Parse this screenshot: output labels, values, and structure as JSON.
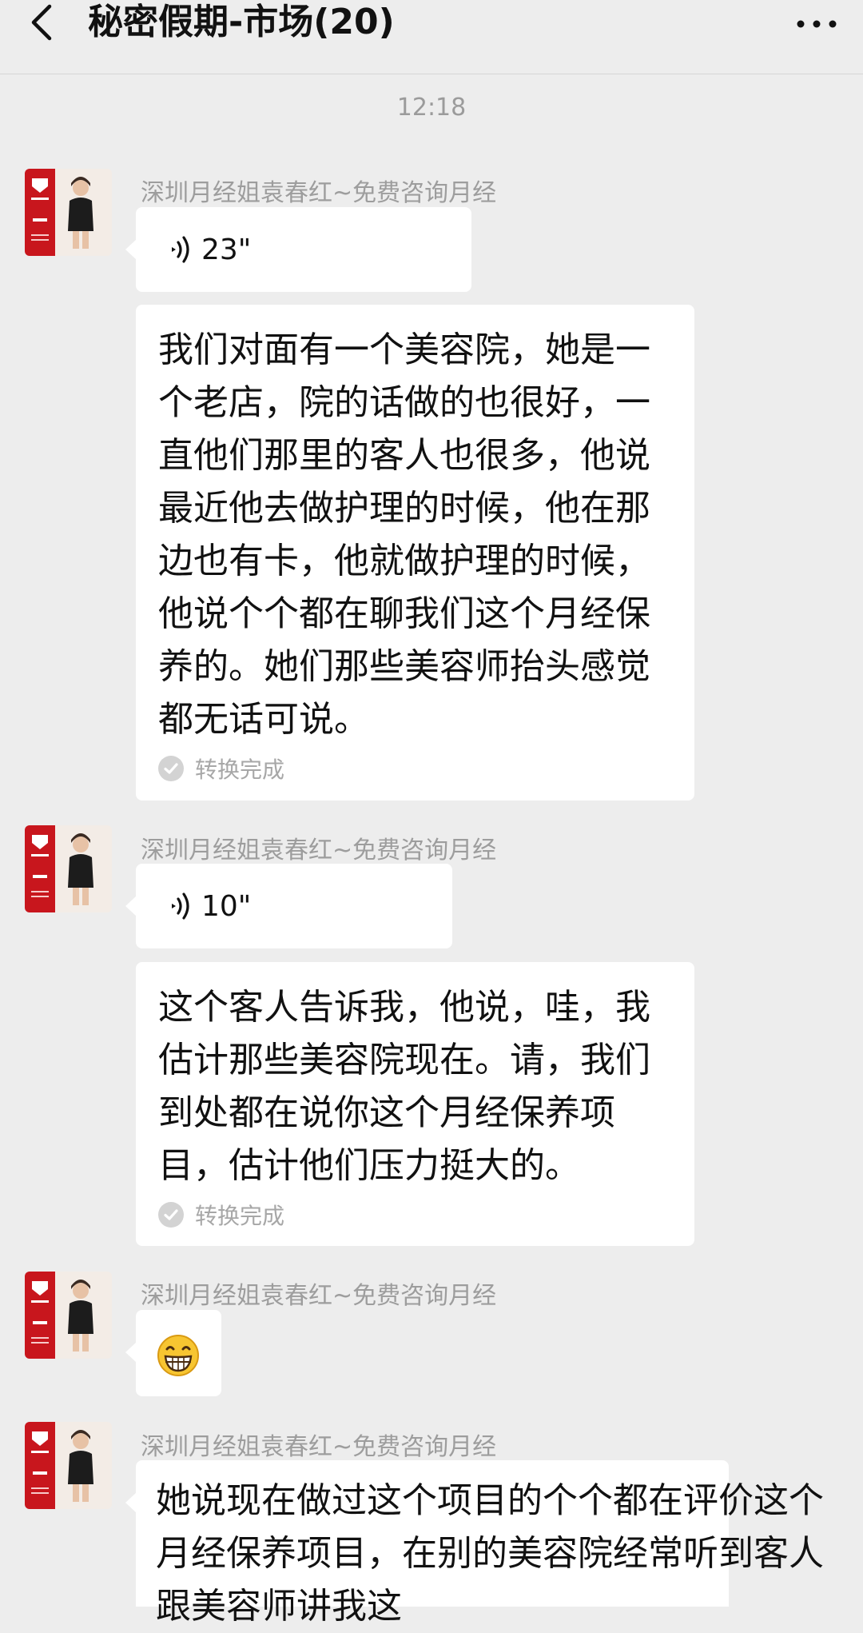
{
  "header": {
    "title": "秘密假期-市场(20)",
    "back_icon": "chevron-left-icon",
    "more_icon": "more-dots-icon"
  },
  "timestamp": "12:18",
  "avatar": {
    "accent": "#c8161d",
    "badge_text": "袁春红"
  },
  "messages": [
    {
      "sender": "深圳月经姐袁春红~免费咨询月经",
      "voice_duration": "23\"",
      "transcript": "我们对面有一个美容院，她是一个老店，院的话做的也很好，一直他们那里的客人也很多，他说最近他去做护理的时候，他在那边也有卡，他就做护理的时候，他说个个都在聊我们这个月经保养的。她们那些美容师抬头感觉都无话可说。",
      "transcript_status": "转换完成"
    },
    {
      "sender": "深圳月经姐袁春红~免费咨询月经",
      "voice_duration": "10\"",
      "transcript": "这个客人告诉我，他说，哇，我估计那些美容院现在。请，我们到处都在说你这个月经保养项目，估计他们压力挺大的。",
      "transcript_status": "转换完成"
    },
    {
      "sender": "深圳月经姐袁春红~免费咨询月经",
      "emoji": "grinning-face-icon"
    },
    {
      "sender": "深圳月经姐袁春红~免费咨询月经",
      "text": "她说现在做过这个项目的个个都在评价这个月经保养项目，在别的美容院经常听到客人跟美容师讲我这"
    }
  ]
}
